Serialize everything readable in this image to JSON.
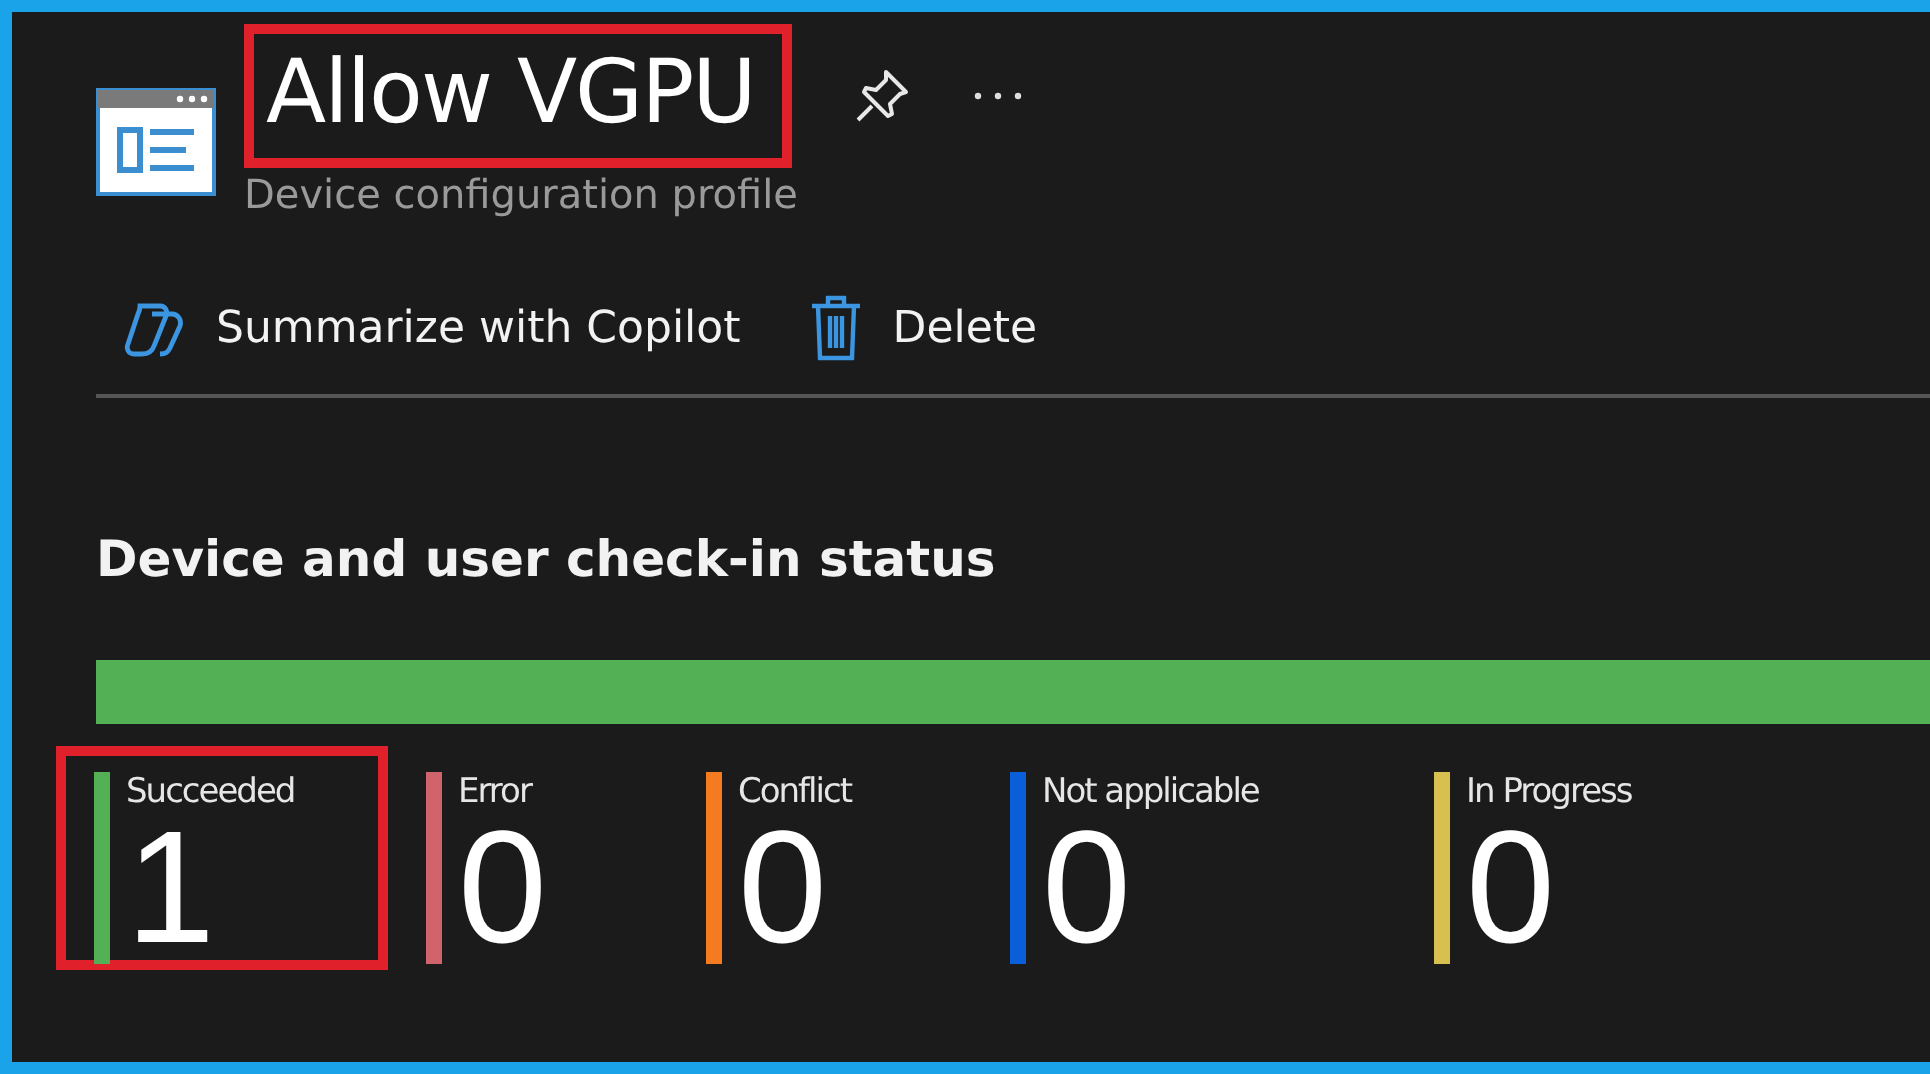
{
  "header": {
    "title": "Allow VGPU",
    "title_highlighted": true,
    "subtitle": "Device configuration profile"
  },
  "toolbar": [
    {
      "kind": "copilot",
      "label": "Summarize with Copilot"
    },
    {
      "kind": "delete",
      "label": "Delete"
    }
  ],
  "section": {
    "title": "Device and user check-in status"
  },
  "statuses": [
    {
      "label": "Succeeded",
      "count": "1",
      "color": "#54b054",
      "highlighted": true
    },
    {
      "label": "Error",
      "count": "0",
      "color": "#d0636b",
      "highlighted": false
    },
    {
      "label": "Conflict",
      "count": "0",
      "color": "#f47b20",
      "highlighted": false
    },
    {
      "label": "Not applicable",
      "count": "0",
      "color": "#0a5fd8",
      "highlighted": false
    },
    {
      "label": "In Progress",
      "count": "0",
      "color": "#d8c050",
      "highlighted": false
    }
  ]
}
